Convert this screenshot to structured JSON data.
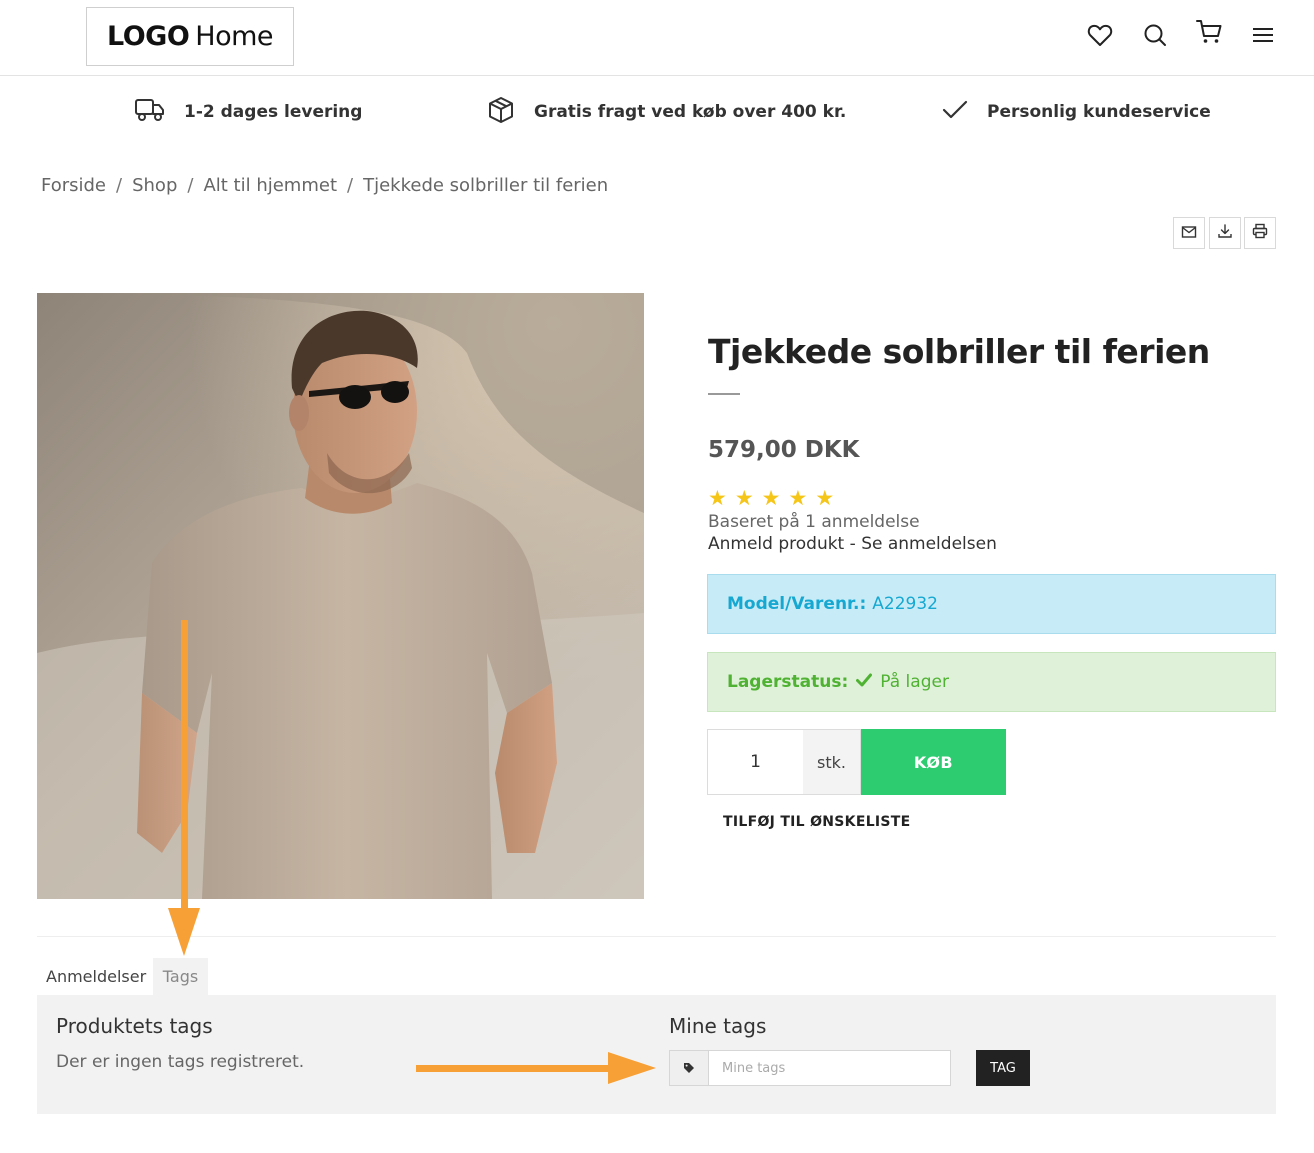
{
  "header": {
    "logo_bold": "LOGO",
    "logo_text": "Home",
    "icons": [
      "heart-icon",
      "search-icon",
      "cart-icon",
      "menu-icon"
    ]
  },
  "usp": {
    "delivery": "1-2 dages levering",
    "freight": "Gratis fragt ved køb over 400 kr.",
    "service": "Personlig kundeservice"
  },
  "breadcrumb": {
    "items": [
      "Forside",
      "Shop",
      "Alt til hjemmet",
      "Tjekkede solbriller til ferien"
    ],
    "separator": "/"
  },
  "product": {
    "title": "Tjekkede solbriller til ferien",
    "price": "579,00 DKK",
    "rating": 5,
    "rating_max": 5,
    "based_on": "Baseret på 1 anmeldelse",
    "review_link": "Anmeld produkt",
    "review_sep": " - ",
    "see_reviews_link": "Se anmeldelsen",
    "model_label": "Model/Varenr.:",
    "model_value": "A22932",
    "stock_label": "Lagerstatus:",
    "stock_value": "På lager",
    "quantity": "1",
    "unit": "stk.",
    "buy_label": "KØB",
    "wishlist_label": "TILFØJ TIL ØNSKELISTE"
  },
  "tabs": {
    "items": [
      "Anmeldelser",
      "Tags"
    ],
    "active": "Tags"
  },
  "tags_panel": {
    "product_tags_heading": "Produktets tags",
    "product_tags_empty": "Der er ingen tags registreret.",
    "my_tags_heading": "Mine tags",
    "my_tags_placeholder": "Mine tags",
    "tag_button": "TAG"
  },
  "colors": {
    "accent_green": "#2ecc71",
    "info_blue_bg": "#c8ecf7",
    "info_blue_text": "#17a8d1",
    "success_bg": "#dff1d9",
    "success_text": "#4fb232",
    "star": "#f5c518",
    "annotation_arrow": "#f7a035"
  }
}
